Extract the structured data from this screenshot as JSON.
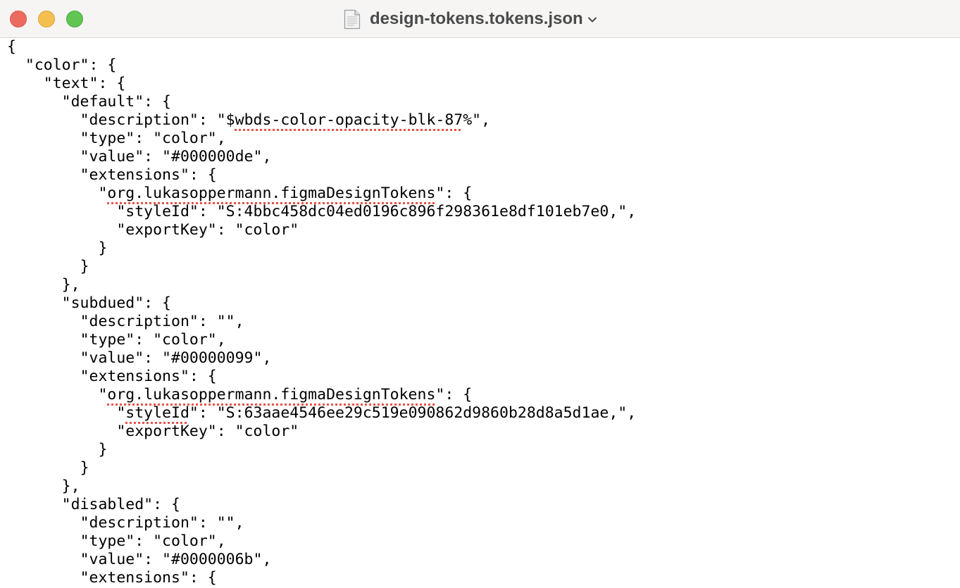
{
  "window": {
    "title": "design-tokens.tokens.json",
    "icons": {
      "close": "close-button-red",
      "minimize": "minimize-button-yellow",
      "zoom": "zoom-button-green",
      "document": "document-icon",
      "chevron": "chevron-down-icon"
    }
  },
  "editor": {
    "lines": [
      {
        "indent": "",
        "text": "{"
      },
      {
        "indent": "  ",
        "text": "\"color\": {"
      },
      {
        "indent": "    ",
        "text": "\"text\": {"
      },
      {
        "indent": "      ",
        "text": "\"default\": {"
      },
      {
        "indent": "        ",
        "pre": "\"description\": \"$",
        "spell": "wbds-color-opacity-blk-87",
        "post": "%\","
      },
      {
        "indent": "        ",
        "text": "\"type\": \"color\","
      },
      {
        "indent": "        ",
        "text": "\"value\": \"#000000de\","
      },
      {
        "indent": "        ",
        "text": "\"extensions\": {"
      },
      {
        "indent": "          ",
        "pre": "\"",
        "spell": "org.lukasoppermann.figmaDesignTokens",
        "post": "\": {"
      },
      {
        "indent": "            ",
        "text": "\"styleId\": \"S:4bbc458dc04ed0196c896f298361e8df101eb7e0,\","
      },
      {
        "indent": "            ",
        "text": "\"exportKey\": \"color\""
      },
      {
        "indent": "          ",
        "text": "}"
      },
      {
        "indent": "        ",
        "text": "}"
      },
      {
        "indent": "      ",
        "text": "},"
      },
      {
        "indent": "      ",
        "text": "\"subdued\": {"
      },
      {
        "indent": "        ",
        "text": "\"description\": \"\","
      },
      {
        "indent": "        ",
        "text": "\"type\": \"color\","
      },
      {
        "indent": "        ",
        "text": "\"value\": \"#00000099\","
      },
      {
        "indent": "        ",
        "text": "\"extensions\": {"
      },
      {
        "indent": "          ",
        "pre": "\"",
        "spell": "org.lukasoppermann.figmaDesignTokens",
        "post": "\": {"
      },
      {
        "indent": "            ",
        "pre": "\"",
        "spell": "styleId",
        "post": "\": \"S:63aae4546ee29c519e090862d9860b28d8a5d1ae,\","
      },
      {
        "indent": "            ",
        "text": "\"exportKey\": \"color\""
      },
      {
        "indent": "          ",
        "text": "}"
      },
      {
        "indent": "        ",
        "text": "}"
      },
      {
        "indent": "      ",
        "text": "},"
      },
      {
        "indent": "      ",
        "text": "\"disabled\": {"
      },
      {
        "indent": "        ",
        "text": "\"description\": \"\","
      },
      {
        "indent": "        ",
        "text": "\"type\": \"color\","
      },
      {
        "indent": "        ",
        "text": "\"value\": \"#0000006b\","
      },
      {
        "indent": "        ",
        "text": "\"extensions\": {"
      }
    ]
  },
  "colors": {
    "titlebar_bg": "#f6f5f4",
    "spellcheck_underline": "#e8524a",
    "text": "#000000"
  }
}
